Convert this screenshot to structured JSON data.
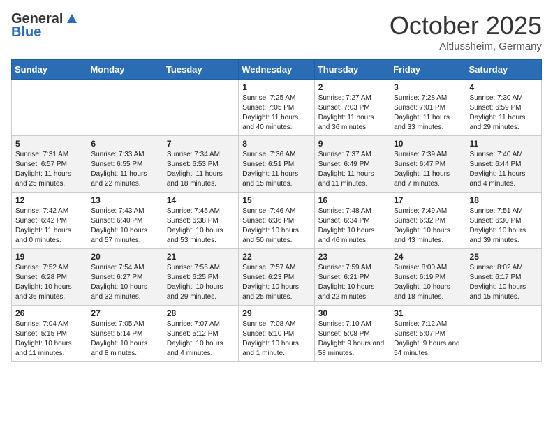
{
  "header": {
    "logo_general": "General",
    "logo_blue": "Blue",
    "month": "October 2025",
    "location": "Altlussheim, Germany"
  },
  "days_of_week": [
    "Sunday",
    "Monday",
    "Tuesday",
    "Wednesday",
    "Thursday",
    "Friday",
    "Saturday"
  ],
  "weeks": [
    [
      {
        "day": "",
        "sunrise": "",
        "sunset": "",
        "daylight": ""
      },
      {
        "day": "",
        "sunrise": "",
        "sunset": "",
        "daylight": ""
      },
      {
        "day": "",
        "sunrise": "",
        "sunset": "",
        "daylight": ""
      },
      {
        "day": "1",
        "sunrise": "Sunrise: 7:25 AM",
        "sunset": "Sunset: 7:05 PM",
        "daylight": "Daylight: 11 hours and 40 minutes."
      },
      {
        "day": "2",
        "sunrise": "Sunrise: 7:27 AM",
        "sunset": "Sunset: 7:03 PM",
        "daylight": "Daylight: 11 hours and 36 minutes."
      },
      {
        "day": "3",
        "sunrise": "Sunrise: 7:28 AM",
        "sunset": "Sunset: 7:01 PM",
        "daylight": "Daylight: 11 hours and 33 minutes."
      },
      {
        "day": "4",
        "sunrise": "Sunrise: 7:30 AM",
        "sunset": "Sunset: 6:59 PM",
        "daylight": "Daylight: 11 hours and 29 minutes."
      }
    ],
    [
      {
        "day": "5",
        "sunrise": "Sunrise: 7:31 AM",
        "sunset": "Sunset: 6:57 PM",
        "daylight": "Daylight: 11 hours and 25 minutes."
      },
      {
        "day": "6",
        "sunrise": "Sunrise: 7:33 AM",
        "sunset": "Sunset: 6:55 PM",
        "daylight": "Daylight: 11 hours and 22 minutes."
      },
      {
        "day": "7",
        "sunrise": "Sunrise: 7:34 AM",
        "sunset": "Sunset: 6:53 PM",
        "daylight": "Daylight: 11 hours and 18 minutes."
      },
      {
        "day": "8",
        "sunrise": "Sunrise: 7:36 AM",
        "sunset": "Sunset: 6:51 PM",
        "daylight": "Daylight: 11 hours and 15 minutes."
      },
      {
        "day": "9",
        "sunrise": "Sunrise: 7:37 AM",
        "sunset": "Sunset: 6:49 PM",
        "daylight": "Daylight: 11 hours and 11 minutes."
      },
      {
        "day": "10",
        "sunrise": "Sunrise: 7:39 AM",
        "sunset": "Sunset: 6:47 PM",
        "daylight": "Daylight: 11 hours and 7 minutes."
      },
      {
        "day": "11",
        "sunrise": "Sunrise: 7:40 AM",
        "sunset": "Sunset: 6:44 PM",
        "daylight": "Daylight: 11 hours and 4 minutes."
      }
    ],
    [
      {
        "day": "12",
        "sunrise": "Sunrise: 7:42 AM",
        "sunset": "Sunset: 6:42 PM",
        "daylight": "Daylight: 11 hours and 0 minutes."
      },
      {
        "day": "13",
        "sunrise": "Sunrise: 7:43 AM",
        "sunset": "Sunset: 6:40 PM",
        "daylight": "Daylight: 10 hours and 57 minutes."
      },
      {
        "day": "14",
        "sunrise": "Sunrise: 7:45 AM",
        "sunset": "Sunset: 6:38 PM",
        "daylight": "Daylight: 10 hours and 53 minutes."
      },
      {
        "day": "15",
        "sunrise": "Sunrise: 7:46 AM",
        "sunset": "Sunset: 6:36 PM",
        "daylight": "Daylight: 10 hours and 50 minutes."
      },
      {
        "day": "16",
        "sunrise": "Sunrise: 7:48 AM",
        "sunset": "Sunset: 6:34 PM",
        "daylight": "Daylight: 10 hours and 46 minutes."
      },
      {
        "day": "17",
        "sunrise": "Sunrise: 7:49 AM",
        "sunset": "Sunset: 6:32 PM",
        "daylight": "Daylight: 10 hours and 43 minutes."
      },
      {
        "day": "18",
        "sunrise": "Sunrise: 7:51 AM",
        "sunset": "Sunset: 6:30 PM",
        "daylight": "Daylight: 10 hours and 39 minutes."
      }
    ],
    [
      {
        "day": "19",
        "sunrise": "Sunrise: 7:52 AM",
        "sunset": "Sunset: 6:28 PM",
        "daylight": "Daylight: 10 hours and 36 minutes."
      },
      {
        "day": "20",
        "sunrise": "Sunrise: 7:54 AM",
        "sunset": "Sunset: 6:27 PM",
        "daylight": "Daylight: 10 hours and 32 minutes."
      },
      {
        "day": "21",
        "sunrise": "Sunrise: 7:56 AM",
        "sunset": "Sunset: 6:25 PM",
        "daylight": "Daylight: 10 hours and 29 minutes."
      },
      {
        "day": "22",
        "sunrise": "Sunrise: 7:57 AM",
        "sunset": "Sunset: 6:23 PM",
        "daylight": "Daylight: 10 hours and 25 minutes."
      },
      {
        "day": "23",
        "sunrise": "Sunrise: 7:59 AM",
        "sunset": "Sunset: 6:21 PM",
        "daylight": "Daylight: 10 hours and 22 minutes."
      },
      {
        "day": "24",
        "sunrise": "Sunrise: 8:00 AM",
        "sunset": "Sunset: 6:19 PM",
        "daylight": "Daylight: 10 hours and 18 minutes."
      },
      {
        "day": "25",
        "sunrise": "Sunrise: 8:02 AM",
        "sunset": "Sunset: 6:17 PM",
        "daylight": "Daylight: 10 hours and 15 minutes."
      }
    ],
    [
      {
        "day": "26",
        "sunrise": "Sunrise: 7:04 AM",
        "sunset": "Sunset: 5:15 PM",
        "daylight": "Daylight: 10 hours and 11 minutes."
      },
      {
        "day": "27",
        "sunrise": "Sunrise: 7:05 AM",
        "sunset": "Sunset: 5:14 PM",
        "daylight": "Daylight: 10 hours and 8 minutes."
      },
      {
        "day": "28",
        "sunrise": "Sunrise: 7:07 AM",
        "sunset": "Sunset: 5:12 PM",
        "daylight": "Daylight: 10 hours and 4 minutes."
      },
      {
        "day": "29",
        "sunrise": "Sunrise: 7:08 AM",
        "sunset": "Sunset: 5:10 PM",
        "daylight": "Daylight: 10 hours and 1 minute."
      },
      {
        "day": "30",
        "sunrise": "Sunrise: 7:10 AM",
        "sunset": "Sunset: 5:08 PM",
        "daylight": "Daylight: 9 hours and 58 minutes."
      },
      {
        "day": "31",
        "sunrise": "Sunrise: 7:12 AM",
        "sunset": "Sunset: 5:07 PM",
        "daylight": "Daylight: 9 hours and 54 minutes."
      },
      {
        "day": "",
        "sunrise": "",
        "sunset": "",
        "daylight": ""
      }
    ]
  ]
}
